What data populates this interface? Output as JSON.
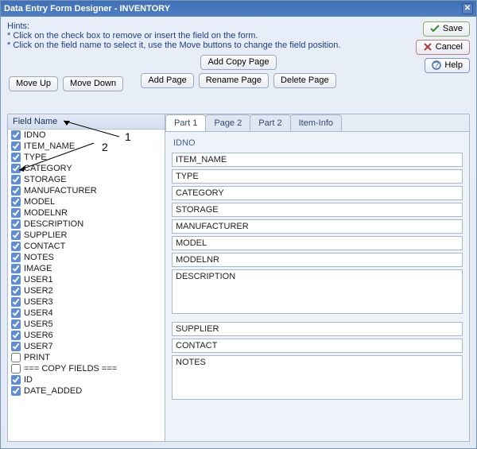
{
  "window": {
    "title": "Data Entry Form Designer - INVENTORY"
  },
  "hints": {
    "heading": "Hints:",
    "line1": "* Click on the check box to remove or insert the field on the form.",
    "line2": "* Click on the field name to select it, use the Move buttons to change the field position."
  },
  "buttons": {
    "save": "Save",
    "cancel": "Cancel",
    "help": "Help",
    "add_copy_page": "Add Copy Page",
    "add_page": "Add Page",
    "rename_page": "Rename Page",
    "delete_page": "Delete Page",
    "move_up": "Move Up",
    "move_down": "Move Down"
  },
  "left": {
    "header": "Field Name",
    "fields": [
      {
        "label": "IDNO",
        "checked": true
      },
      {
        "label": "ITEM_NAME",
        "checked": true
      },
      {
        "label": "TYPE",
        "checked": true
      },
      {
        "label": "CATEGORY",
        "checked": true
      },
      {
        "label": "STORAGE",
        "checked": true
      },
      {
        "label": "MANUFACTURER",
        "checked": true
      },
      {
        "label": "MODEL",
        "checked": true
      },
      {
        "label": "MODELNR",
        "checked": true
      },
      {
        "label": "DESCRIPTION",
        "checked": true
      },
      {
        "label": "SUPPLIER",
        "checked": true
      },
      {
        "label": "CONTACT",
        "checked": true
      },
      {
        "label": "NOTES",
        "checked": true
      },
      {
        "label": "IMAGE",
        "checked": true
      },
      {
        "label": "USER1",
        "checked": true
      },
      {
        "label": "USER2",
        "checked": true
      },
      {
        "label": "USER3",
        "checked": true
      },
      {
        "label": "USER4",
        "checked": true
      },
      {
        "label": "USER5",
        "checked": true
      },
      {
        "label": "USER6",
        "checked": true
      },
      {
        "label": "USER7",
        "checked": true
      },
      {
        "label": "PRINT",
        "checked": false
      },
      {
        "label": "=== COPY FIELDS ===",
        "checked": false
      },
      {
        "label": "ID",
        "checked": true
      },
      {
        "label": "DATE_ADDED",
        "checked": true
      }
    ]
  },
  "tabs": [
    "Part 1",
    "Page 2",
    "Part 2",
    "Item-Info"
  ],
  "active_tab": 0,
  "form": {
    "idno_label": "IDNO",
    "fields_text": [
      "ITEM_NAME",
      "TYPE",
      "CATEGORY",
      "STORAGE",
      "MANUFACTURER",
      "MODEL",
      "MODELNR"
    ],
    "textarea1": "DESCRIPTION",
    "fields_text2": [
      "SUPPLIER",
      "CONTACT"
    ],
    "textarea2": "NOTES"
  },
  "annotations": {
    "one": "1",
    "two": "2"
  }
}
